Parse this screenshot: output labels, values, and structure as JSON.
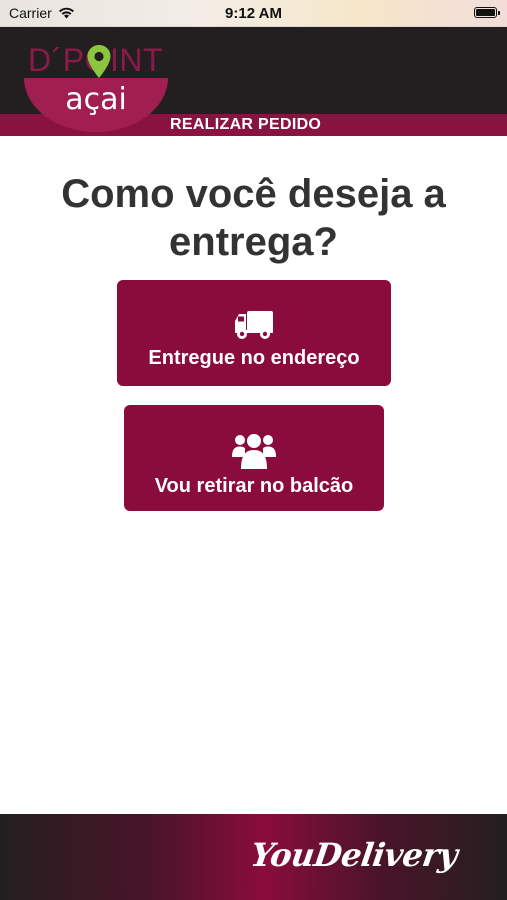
{
  "status_bar": {
    "carrier": "Carrier",
    "time": "9:12 AM",
    "icons": [
      "wifi-icon",
      "battery-icon"
    ]
  },
  "header": {
    "logo_top": "D´POINT",
    "logo_bottom": "açai",
    "title": "REALIZAR PEDIDO"
  },
  "main": {
    "question": "Como você deseja a entrega?",
    "options": [
      {
        "label": "Entregue no endereço",
        "icon": "truck-icon"
      },
      {
        "label": "Vou retirar no balcão",
        "icon": "users-icon"
      }
    ]
  },
  "footer": {
    "brand": "YouDelivery"
  },
  "colors": {
    "primary": "#8a0c3c",
    "header_bg": "#231f20",
    "text": "#333333",
    "pin_green": "#8cc63f"
  }
}
